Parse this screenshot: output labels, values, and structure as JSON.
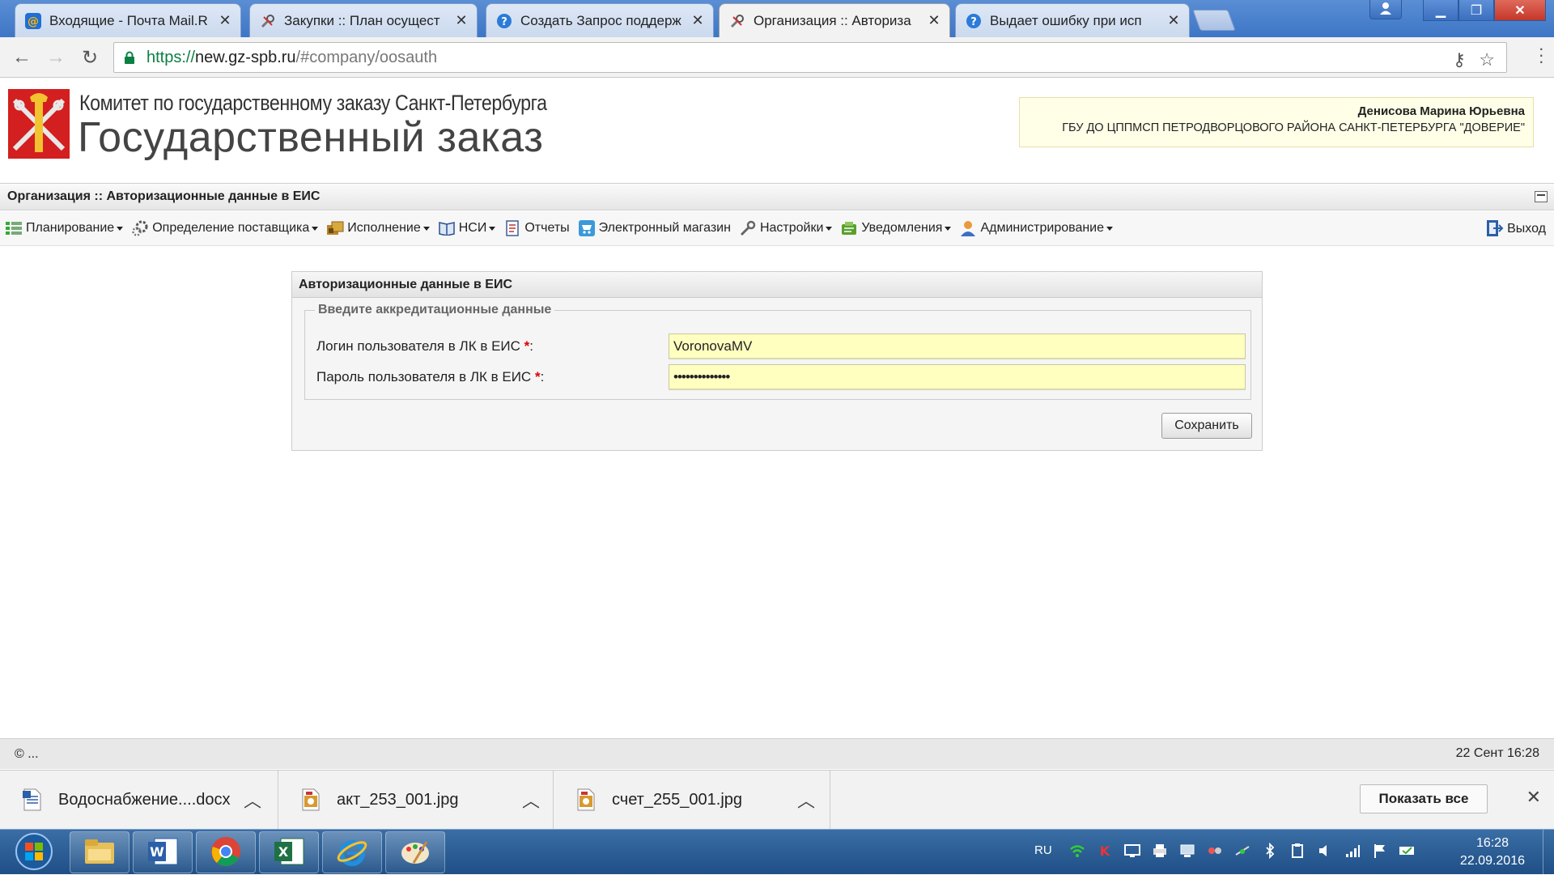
{
  "browser": {
    "tabs": [
      {
        "title": "Входящие - Почта Mail.R",
        "icon": "mail-at-icon"
      },
      {
        "title": "Закупки :: План осущест",
        "icon": "tools-icon"
      },
      {
        "title": "Создать Запрос поддерж",
        "icon": "help-icon"
      },
      {
        "title": "Организация :: Авториза",
        "icon": "tools-icon",
        "active": true
      },
      {
        "title": "Выдает ошибку при исп",
        "icon": "help-icon"
      }
    ],
    "url": {
      "scheme": "https://",
      "host": "new.gz-spb.ru",
      "path": "/#company/oosauth"
    }
  },
  "header": {
    "org_title": "Комитет по государственному заказу Санкт-Петербурга",
    "site_title": "Государственный заказ",
    "user_name": "Денисова Марина Юрьевна",
    "user_org": "ГБУ ДО ЦППМСП ПЕТРОДВОРЦОВОГО РАЙОНА САНКТ-ПЕТЕРБУРГА \"ДОВЕРИЕ\""
  },
  "breadcrumb": "Организация :: Авторизационные данные в ЕИС",
  "menu": [
    {
      "label": "Планирование",
      "icon": "planning-icon",
      "dropdown": true
    },
    {
      "label": "Определение поставщика",
      "icon": "gears-icon",
      "dropdown": true
    },
    {
      "label": "Исполнение",
      "icon": "execution-icon",
      "dropdown": true
    },
    {
      "label": "НСИ",
      "icon": "book-icon",
      "dropdown": true
    },
    {
      "label": "Отчеты",
      "icon": "report-icon",
      "dropdown": false
    },
    {
      "label": "Электронный магазин",
      "icon": "cart-icon",
      "dropdown": false
    },
    {
      "label": "Настройки",
      "icon": "wrench-icon",
      "dropdown": true
    },
    {
      "label": "Уведомления",
      "icon": "notifications-icon",
      "dropdown": true
    },
    {
      "label": "Администрирование",
      "icon": "user-icon",
      "dropdown": true
    }
  ],
  "logout_label": "Выход",
  "panel": {
    "title": "Авторизационные данные в ЕИС",
    "legend": "Введите аккредитационные данные",
    "login_label": "Логин пользователя в ЛК в ЕИС",
    "login_value": "VoronovaMV",
    "password_label": "Пароль пользователя в ЛК в ЕИС",
    "password_value": "••••••••••••••",
    "required_mark": "*",
    "save_label": "Сохранить"
  },
  "footer": {
    "copyright": "© ...",
    "datetime": "22 Сент 16:28"
  },
  "downloads": {
    "items": [
      {
        "name": "Водоснабжение....docx",
        "icon": "docx-file-icon"
      },
      {
        "name": "акт_253_001.jpg",
        "icon": "jpg-file-icon"
      },
      {
        "name": "счет_255_001.jpg",
        "icon": "jpg-file-icon"
      }
    ],
    "show_all": "Показать все"
  },
  "taskbar": {
    "apps": [
      "file-explorer-icon",
      "word-icon",
      "chrome-icon",
      "excel-icon",
      "internet-explorer-icon",
      "paint-icon"
    ],
    "lang": "RU",
    "time": "16:28",
    "date": "22.09.2016"
  },
  "colors": {
    "input_bg": "#ffffc0",
    "userbox_bg": "#ffffe8",
    "required": "#dd0000",
    "taskbar": "#2a5d96"
  }
}
